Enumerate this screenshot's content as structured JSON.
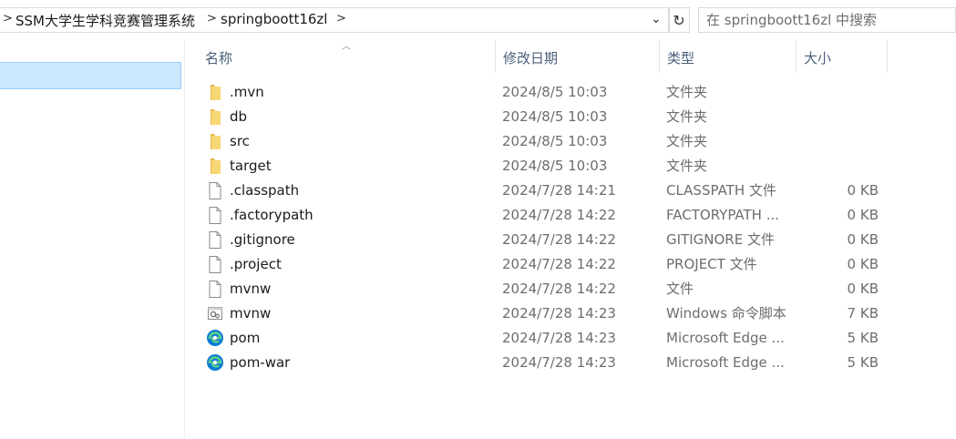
{
  "address": {
    "crumbs": [
      "SSM大学生学科竞赛管理系统",
      "springboott16zl"
    ],
    "sep_glyph": ">",
    "dropdown_glyph": "⌄",
    "refresh_glyph": "↻"
  },
  "search": {
    "placeholder": "在 springboott16zl 中搜索"
  },
  "columns": {
    "name": "名称",
    "date": "修改日期",
    "type": "类型",
    "size": "大小"
  },
  "files": [
    {
      "icon": "folder-icon",
      "name": ".mvn",
      "date": "2024/8/5 10:03",
      "type": "文件夹",
      "size": ""
    },
    {
      "icon": "folder-icon",
      "name": "db",
      "date": "2024/8/5 10:03",
      "type": "文件夹",
      "size": ""
    },
    {
      "icon": "folder-icon",
      "name": "src",
      "date": "2024/8/5 10:03",
      "type": "文件夹",
      "size": ""
    },
    {
      "icon": "folder-icon",
      "name": "target",
      "date": "2024/8/5 10:03",
      "type": "文件夹",
      "size": ""
    },
    {
      "icon": "file-icon",
      "name": ".classpath",
      "date": "2024/7/28 14:21",
      "type": "CLASSPATH 文件",
      "size": "0 KB"
    },
    {
      "icon": "file-icon",
      "name": ".factorypath",
      "date": "2024/7/28 14:22",
      "type": "FACTORYPATH ...",
      "size": "0 KB"
    },
    {
      "icon": "file-icon",
      "name": ".gitignore",
      "date": "2024/7/28 14:22",
      "type": "GITIGNORE 文件",
      "size": "0 KB"
    },
    {
      "icon": "file-icon",
      "name": ".project",
      "date": "2024/7/28 14:22",
      "type": "PROJECT 文件",
      "size": "0 KB"
    },
    {
      "icon": "file-icon",
      "name": "mvnw",
      "date": "2024/7/28 14:22",
      "type": "文件",
      "size": "0 KB"
    },
    {
      "icon": "script-icon",
      "name": "mvnw",
      "date": "2024/7/28 14:23",
      "type": "Windows 命令脚本",
      "size": "7 KB"
    },
    {
      "icon": "edge-icon",
      "name": "pom",
      "date": "2024/7/28 14:23",
      "type": "Microsoft Edge ...",
      "size": "5 KB"
    },
    {
      "icon": "edge-icon",
      "name": "pom-war",
      "date": "2024/7/28 14:23",
      "type": "Microsoft Edge ...",
      "size": "5 KB"
    }
  ],
  "colors": {
    "selection": "#cce8ff",
    "folder": "#f8d775",
    "edge": "#0c7bd6"
  }
}
